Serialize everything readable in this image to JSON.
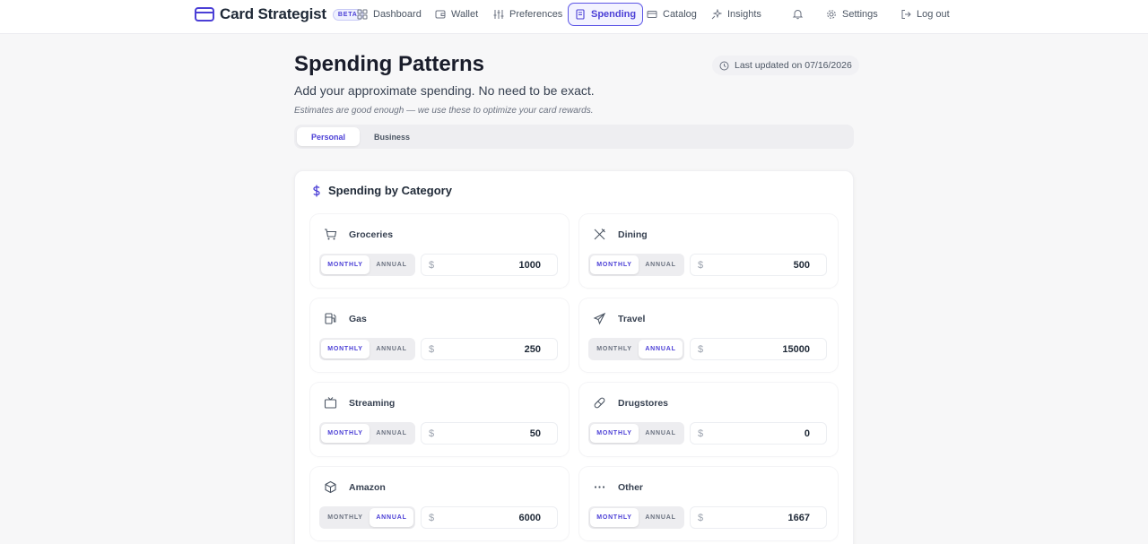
{
  "brand": {
    "name": "Card Strategist",
    "badge": "BETA"
  },
  "nav": {
    "items": [
      {
        "label": "Dashboard",
        "icon": "grid-icon",
        "active": false
      },
      {
        "label": "Wallet",
        "icon": "wallet-icon",
        "active": false
      },
      {
        "label": "Preferences",
        "icon": "sliders-icon",
        "active": false
      },
      {
        "label": "Spending",
        "icon": "receipt-icon",
        "active": true
      },
      {
        "label": "Catalog",
        "icon": "card-icon",
        "active": false
      },
      {
        "label": "Insights",
        "icon": "sparkle-icon",
        "active": false
      }
    ],
    "settings_label": "Settings",
    "logout_label": "Log out"
  },
  "page": {
    "title": "Spending Patterns",
    "updated": "Last updated on 07/16/2026",
    "subtitle": "Add your approximate spending. No need to be exact.",
    "note": "Estimates are good enough — we use these to optimize your card rewards."
  },
  "tabs": [
    {
      "label": "Personal",
      "active": true
    },
    {
      "label": "Business",
      "active": false
    }
  ],
  "section": {
    "title": "Spending by Category"
  },
  "frequency_labels": {
    "monthly": "MONTHLY",
    "annual": "ANNUAL"
  },
  "currency_symbol": "$",
  "categories": [
    {
      "name": "Groceries",
      "icon": "cart-icon",
      "frequency": "monthly",
      "amount": "1000"
    },
    {
      "name": "Dining",
      "icon": "utensils-icon",
      "frequency": "monthly",
      "amount": "500"
    },
    {
      "name": "Gas",
      "icon": "fuel-icon",
      "frequency": "monthly",
      "amount": "250"
    },
    {
      "name": "Travel",
      "icon": "plane-icon",
      "frequency": "annual",
      "amount": "15000"
    },
    {
      "name": "Streaming",
      "icon": "tv-icon",
      "frequency": "monthly",
      "amount": "50"
    },
    {
      "name": "Drugstores",
      "icon": "pill-icon",
      "frequency": "monthly",
      "amount": "0"
    },
    {
      "name": "Amazon",
      "icon": "package-icon",
      "frequency": "annual",
      "amount": "6000"
    },
    {
      "name": "Other",
      "icon": "ellipsis-icon",
      "frequency": "monthly",
      "amount": "1667"
    }
  ],
  "colors": {
    "accent": "#4b3fd6",
    "background": "#f7f7f8"
  }
}
